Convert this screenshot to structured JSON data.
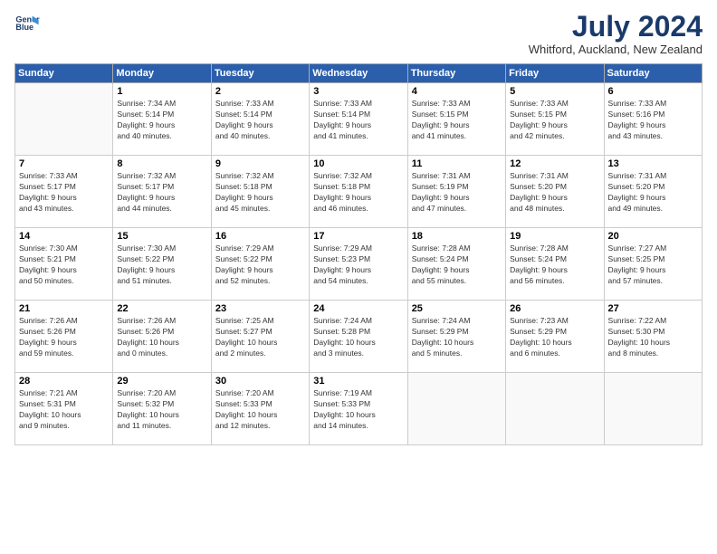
{
  "header": {
    "logo_line1": "General",
    "logo_line2": "Blue",
    "month": "July 2024",
    "location": "Whitford, Auckland, New Zealand"
  },
  "weekdays": [
    "Sunday",
    "Monday",
    "Tuesday",
    "Wednesday",
    "Thursday",
    "Friday",
    "Saturday"
  ],
  "weeks": [
    [
      {
        "day": "",
        "info": ""
      },
      {
        "day": "1",
        "info": "Sunrise: 7:34 AM\nSunset: 5:14 PM\nDaylight: 9 hours\nand 40 minutes."
      },
      {
        "day": "2",
        "info": "Sunrise: 7:33 AM\nSunset: 5:14 PM\nDaylight: 9 hours\nand 40 minutes."
      },
      {
        "day": "3",
        "info": "Sunrise: 7:33 AM\nSunset: 5:14 PM\nDaylight: 9 hours\nand 41 minutes."
      },
      {
        "day": "4",
        "info": "Sunrise: 7:33 AM\nSunset: 5:15 PM\nDaylight: 9 hours\nand 41 minutes."
      },
      {
        "day": "5",
        "info": "Sunrise: 7:33 AM\nSunset: 5:15 PM\nDaylight: 9 hours\nand 42 minutes."
      },
      {
        "day": "6",
        "info": "Sunrise: 7:33 AM\nSunset: 5:16 PM\nDaylight: 9 hours\nand 43 minutes."
      }
    ],
    [
      {
        "day": "7",
        "info": "Sunrise: 7:33 AM\nSunset: 5:17 PM\nDaylight: 9 hours\nand 43 minutes."
      },
      {
        "day": "8",
        "info": "Sunrise: 7:32 AM\nSunset: 5:17 PM\nDaylight: 9 hours\nand 44 minutes."
      },
      {
        "day": "9",
        "info": "Sunrise: 7:32 AM\nSunset: 5:18 PM\nDaylight: 9 hours\nand 45 minutes."
      },
      {
        "day": "10",
        "info": "Sunrise: 7:32 AM\nSunset: 5:18 PM\nDaylight: 9 hours\nand 46 minutes."
      },
      {
        "day": "11",
        "info": "Sunrise: 7:31 AM\nSunset: 5:19 PM\nDaylight: 9 hours\nand 47 minutes."
      },
      {
        "day": "12",
        "info": "Sunrise: 7:31 AM\nSunset: 5:20 PM\nDaylight: 9 hours\nand 48 minutes."
      },
      {
        "day": "13",
        "info": "Sunrise: 7:31 AM\nSunset: 5:20 PM\nDaylight: 9 hours\nand 49 minutes."
      }
    ],
    [
      {
        "day": "14",
        "info": "Sunrise: 7:30 AM\nSunset: 5:21 PM\nDaylight: 9 hours\nand 50 minutes."
      },
      {
        "day": "15",
        "info": "Sunrise: 7:30 AM\nSunset: 5:22 PM\nDaylight: 9 hours\nand 51 minutes."
      },
      {
        "day": "16",
        "info": "Sunrise: 7:29 AM\nSunset: 5:22 PM\nDaylight: 9 hours\nand 52 minutes."
      },
      {
        "day": "17",
        "info": "Sunrise: 7:29 AM\nSunset: 5:23 PM\nDaylight: 9 hours\nand 54 minutes."
      },
      {
        "day": "18",
        "info": "Sunrise: 7:28 AM\nSunset: 5:24 PM\nDaylight: 9 hours\nand 55 minutes."
      },
      {
        "day": "19",
        "info": "Sunrise: 7:28 AM\nSunset: 5:24 PM\nDaylight: 9 hours\nand 56 minutes."
      },
      {
        "day": "20",
        "info": "Sunrise: 7:27 AM\nSunset: 5:25 PM\nDaylight: 9 hours\nand 57 minutes."
      }
    ],
    [
      {
        "day": "21",
        "info": "Sunrise: 7:26 AM\nSunset: 5:26 PM\nDaylight: 9 hours\nand 59 minutes."
      },
      {
        "day": "22",
        "info": "Sunrise: 7:26 AM\nSunset: 5:26 PM\nDaylight: 10 hours\nand 0 minutes."
      },
      {
        "day": "23",
        "info": "Sunrise: 7:25 AM\nSunset: 5:27 PM\nDaylight: 10 hours\nand 2 minutes."
      },
      {
        "day": "24",
        "info": "Sunrise: 7:24 AM\nSunset: 5:28 PM\nDaylight: 10 hours\nand 3 minutes."
      },
      {
        "day": "25",
        "info": "Sunrise: 7:24 AM\nSunset: 5:29 PM\nDaylight: 10 hours\nand 5 minutes."
      },
      {
        "day": "26",
        "info": "Sunrise: 7:23 AM\nSunset: 5:29 PM\nDaylight: 10 hours\nand 6 minutes."
      },
      {
        "day": "27",
        "info": "Sunrise: 7:22 AM\nSunset: 5:30 PM\nDaylight: 10 hours\nand 8 minutes."
      }
    ],
    [
      {
        "day": "28",
        "info": "Sunrise: 7:21 AM\nSunset: 5:31 PM\nDaylight: 10 hours\nand 9 minutes."
      },
      {
        "day": "29",
        "info": "Sunrise: 7:20 AM\nSunset: 5:32 PM\nDaylight: 10 hours\nand 11 minutes."
      },
      {
        "day": "30",
        "info": "Sunrise: 7:20 AM\nSunset: 5:33 PM\nDaylight: 10 hours\nand 12 minutes."
      },
      {
        "day": "31",
        "info": "Sunrise: 7:19 AM\nSunset: 5:33 PM\nDaylight: 10 hours\nand 14 minutes."
      },
      {
        "day": "",
        "info": ""
      },
      {
        "day": "",
        "info": ""
      },
      {
        "day": "",
        "info": ""
      }
    ]
  ]
}
